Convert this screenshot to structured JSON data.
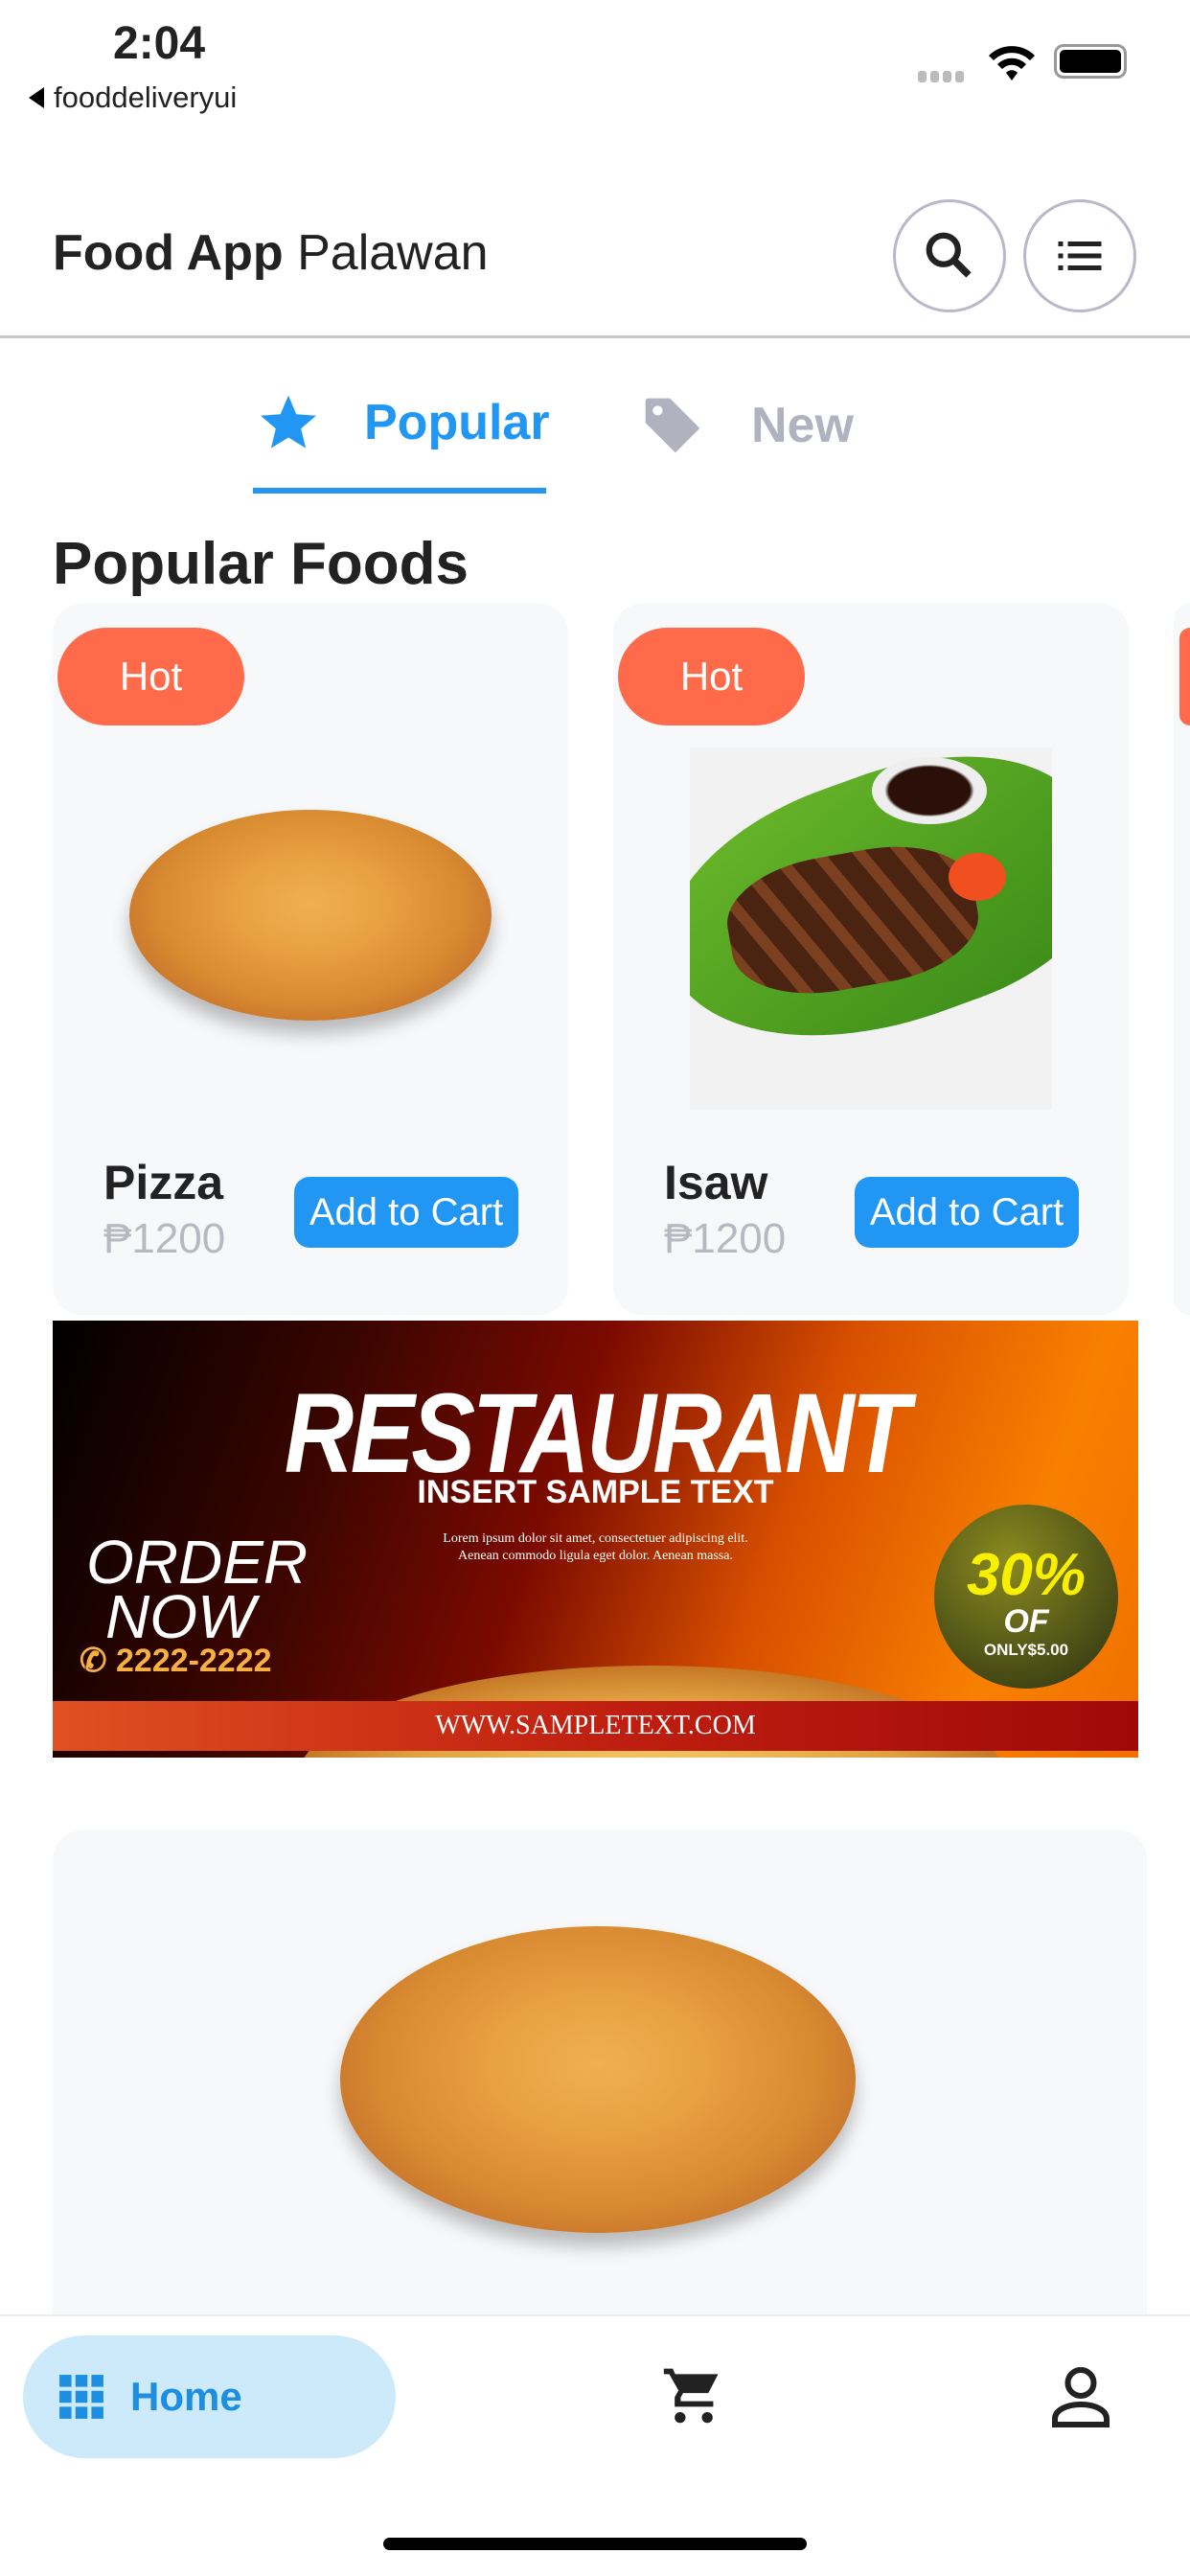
{
  "status": {
    "time": "2:04",
    "back_app": "fooddeliveryui"
  },
  "header": {
    "title_bold": "Food App",
    "title_regular": "Palawan",
    "search_icon": "search-icon",
    "menu_icon": "list-icon"
  },
  "tabs": [
    {
      "label": "Popular",
      "icon": "star-icon",
      "active": true
    },
    {
      "label": "New",
      "icon": "tag-icon",
      "active": false
    }
  ],
  "section_title": "Popular Foods",
  "foods": [
    {
      "badge": "Hot",
      "name": "Pizza",
      "price": "₱1200",
      "button": "Add to Cart"
    },
    {
      "badge": "Hot",
      "name": "Isaw",
      "price": "₱1200",
      "button": "Add to Cart"
    }
  ],
  "banner": {
    "title": "RESTAURANT",
    "subtitle": "INSERT SAMPLE TEXT",
    "lorem1": "Lorem ipsum dolor sit amet, consectetuer adipiscing elit.",
    "lorem2": "Aenean commodo ligula eget dolor. Aenean massa.",
    "order1": "ORDER",
    "order2": "NOW",
    "phone": "2222-2222",
    "discount": "30%",
    "of": "OF",
    "only": "ONLY$5.00",
    "url": "WWW.SAMPLETEXT.COM"
  },
  "nav": {
    "home": "Home",
    "items": [
      "home",
      "cart",
      "profile"
    ]
  },
  "colors": {
    "accent": "#2196f3",
    "hot": "#ff6b4a",
    "home_pill": "#cdeafb"
  }
}
